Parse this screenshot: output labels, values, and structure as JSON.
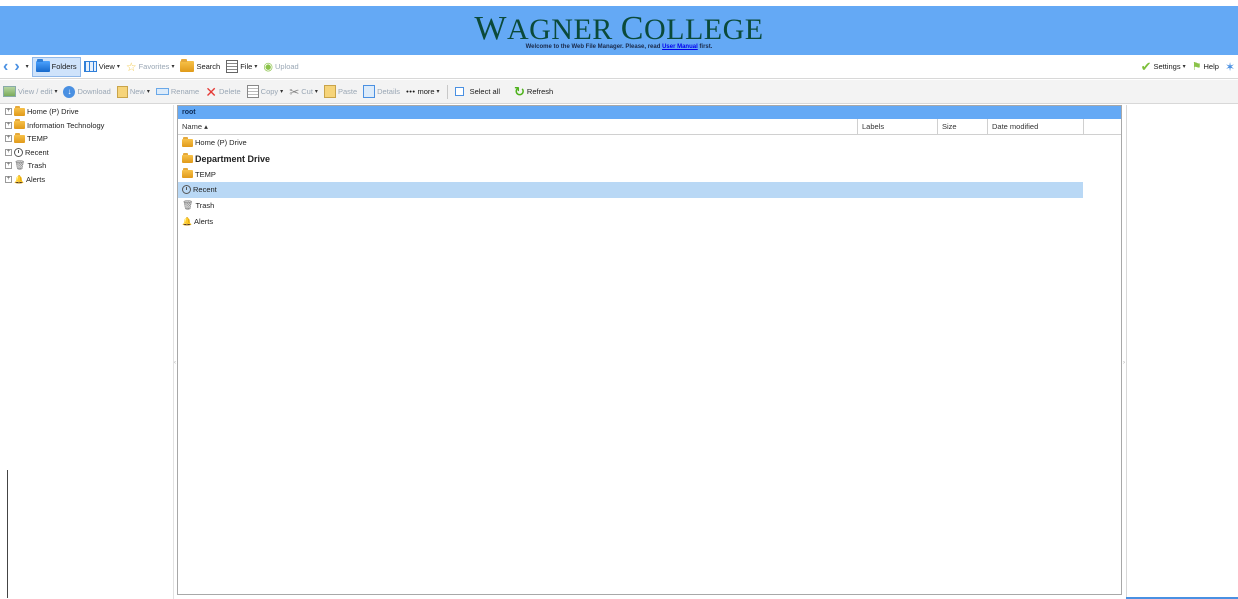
{
  "banner": {
    "logo_first": "W",
    "logo_rest": "AGNER ",
    "logo_first2": "C",
    "logo_rest2": "OLLEGE",
    "welcome_prefix": "Welcome to the Web File Manager. Please, read ",
    "manual_link": "User Manual",
    "welcome_suffix": " first."
  },
  "toolbar1": {
    "folders": "Folders",
    "view": "View",
    "favorites": "Favorites",
    "search": "Search",
    "file": "File",
    "upload": "Upload",
    "settings": "Settings",
    "help": "Help"
  },
  "toolbar2": {
    "view_edit": "View / edit",
    "download": "Download",
    "new": "New",
    "rename": "Rename",
    "delete": "Delete",
    "copy": "Copy",
    "cut": "Cut",
    "paste": "Paste",
    "details": "Details",
    "more": "more",
    "select_all": "Select all",
    "refresh": "Refresh"
  },
  "tree": {
    "items": [
      {
        "label": "Home (P) Drive",
        "icon": "folder-icon"
      },
      {
        "label": "Information Technology",
        "icon": "folder-icon"
      },
      {
        "label": "TEMP",
        "icon": "folder-icon"
      },
      {
        "label": "Recent",
        "icon": "clock-icon"
      },
      {
        "label": "Trash",
        "icon": "trash-icon"
      },
      {
        "label": "Alerts",
        "icon": "bell-icon"
      }
    ]
  },
  "main": {
    "path": "root",
    "columns": {
      "name": "Name",
      "labels": "Labels",
      "size": "Size",
      "date_modified": "Date modified"
    },
    "rows": [
      {
        "label": "Home (P) Drive",
        "icon": "folder-icon"
      },
      {
        "label": "Department Drive",
        "icon": "folder-icon"
      },
      {
        "label": "TEMP",
        "icon": "folder-icon"
      },
      {
        "label": "Recent",
        "icon": "clock-icon"
      },
      {
        "label": "Trash",
        "icon": "trash-icon"
      },
      {
        "label": "Alerts",
        "icon": "bell-icon"
      }
    ]
  },
  "colors": {
    "banner": "#64a9f5",
    "selected_row": "#b9d8f5",
    "logo_text": "#0b4a3a"
  }
}
